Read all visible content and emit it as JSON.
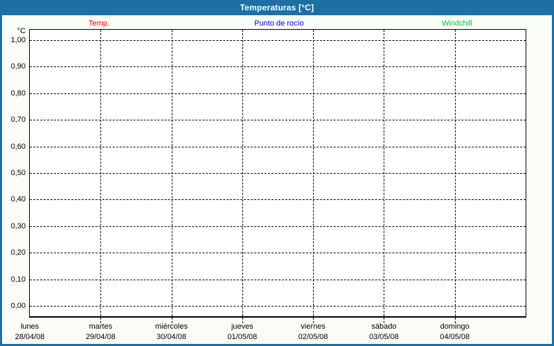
{
  "window": {
    "title": "Temperaturas [°C]"
  },
  "colors": {
    "frame": "#1e6fa4",
    "header_bg": "#1e6fa4",
    "header_text": "#ffffff",
    "page_bg": "#fafcf6",
    "plot_bg": "#ffffff",
    "grid": "#000000",
    "temp": "#ff0000",
    "dew_point": "#0000dd",
    "windchill": "#00cc44"
  },
  "legend": [
    {
      "label": "Temp.",
      "color": "#ff0000"
    },
    {
      "label": "Punto de rocío",
      "color": "#0000dd"
    },
    {
      "label": "Windchill",
      "color": "#00cc44"
    }
  ],
  "y_axis": {
    "unit": "°C",
    "ticks": [
      "1,00",
      "0,90",
      "0,80",
      "0,70",
      "0,60",
      "0,50",
      "0,40",
      "0,30",
      "0,20",
      "0,10",
      "0,00"
    ]
  },
  "x_axis": {
    "days": [
      {
        "name": "lunes",
        "date": "28/04/08"
      },
      {
        "name": "martes",
        "date": "29/04/08"
      },
      {
        "name": "miércoles",
        "date": "30/04/08"
      },
      {
        "name": "jueves",
        "date": "01/05/08"
      },
      {
        "name": "viernes",
        "date": "02/05/08"
      },
      {
        "name": "sábado",
        "date": "03/05/08"
      },
      {
        "name": "domingo",
        "date": "04/05/08"
      }
    ]
  },
  "chart_data": {
    "type": "line",
    "title": "Temperaturas [°C]",
    "xlabel": "",
    "ylabel": "°C",
    "ylim": [
      0.0,
      1.0
    ],
    "y_tick_step": 0.1,
    "grid": "dashed",
    "legend_position": "top",
    "x": [
      "28/04/08",
      "29/04/08",
      "30/04/08",
      "01/05/08",
      "02/05/08",
      "03/05/08",
      "04/05/08"
    ],
    "series": [
      {
        "name": "Temp.",
        "color": "#ff0000",
        "values": []
      },
      {
        "name": "Punto de rocío",
        "color": "#0000dd",
        "values": []
      },
      {
        "name": "Windchill",
        "color": "#00cc44",
        "values": []
      }
    ]
  }
}
